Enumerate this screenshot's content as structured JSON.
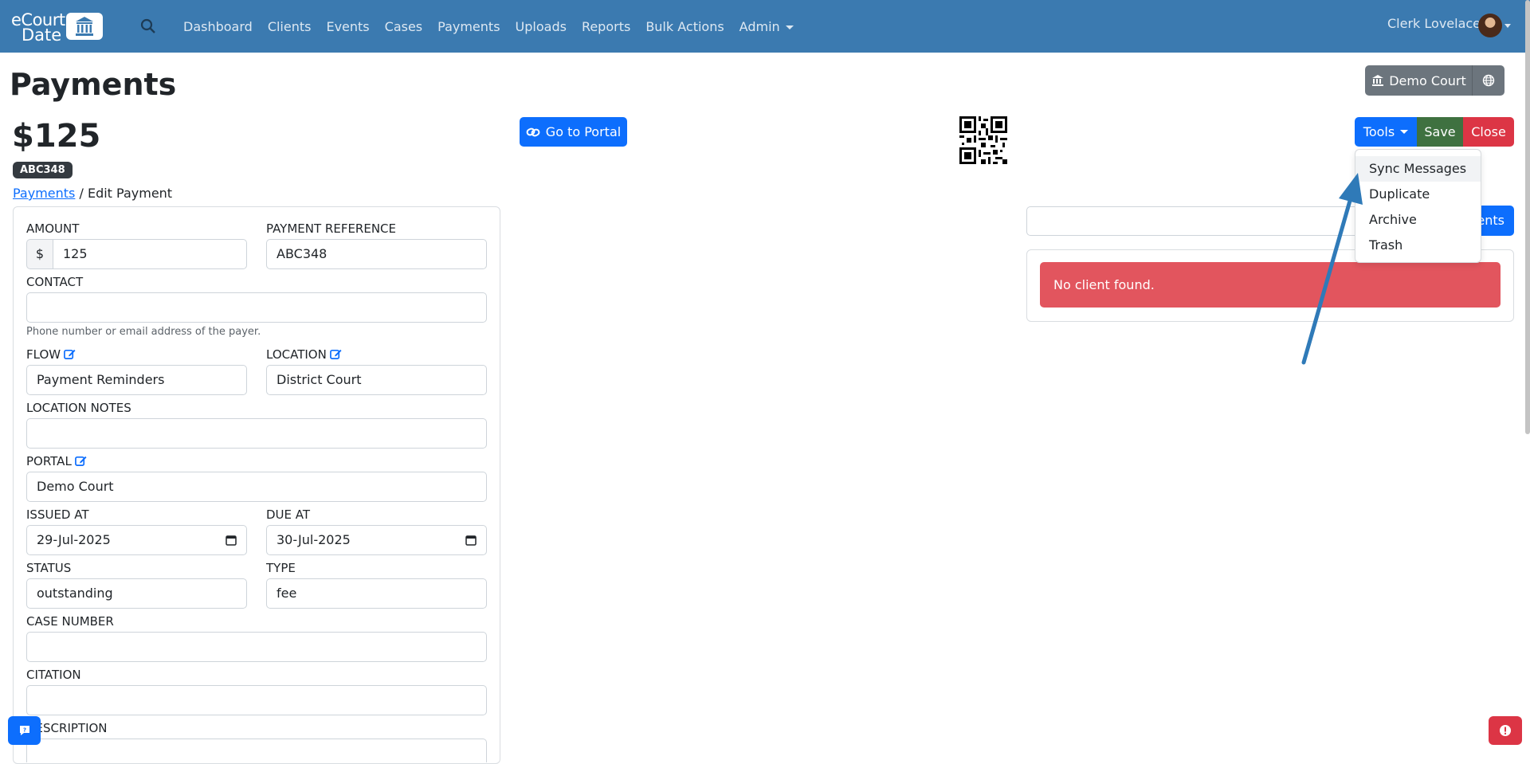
{
  "nav": {
    "brand_line1": "eCourt",
    "brand_line2": "Date",
    "links": [
      "Dashboard",
      "Clients",
      "Events",
      "Cases",
      "Payments",
      "Uploads",
      "Reports",
      "Bulk Actions"
    ],
    "admin_label": "Admin",
    "user_name": "Clerk Lovelace"
  },
  "page": {
    "title": "Payments",
    "court_button": "Demo Court",
    "amount_display": "$125",
    "reference_badge": "ABC348",
    "breadcrumb_link": "Payments",
    "breadcrumb_current": "/ Edit Payment",
    "portal_button": "Go to Portal"
  },
  "toolbar": {
    "tools_label": "Tools",
    "save_label": "Save",
    "close_label": "Close",
    "menu_items": [
      "Sync Messages",
      "Duplicate",
      "Archive",
      "Trash"
    ]
  },
  "form": {
    "amount_label": "AMOUNT",
    "amount_prefix": "$",
    "amount_value": "125",
    "reference_label": "PAYMENT REFERENCE",
    "reference_value": "ABC348",
    "contact_label": "CONTACT",
    "contact_value": "",
    "contact_help": "Phone number or email address of the payer.",
    "flow_label": "FLOW",
    "flow_value": "Payment Reminders",
    "location_label": "LOCATION",
    "location_value": "District Court",
    "location_notes_label": "LOCATION NOTES",
    "location_notes_value": "",
    "portal_label": "PORTAL",
    "portal_value": "Demo Court",
    "issued_label": "ISSUED AT",
    "issued_value": "29-Jul-2025",
    "due_label": "DUE AT",
    "due_value": "30-Jul-2025",
    "status_label": "STATUS",
    "status_value": "outstanding",
    "type_label": "TYPE",
    "type_value": "fee",
    "case_number_label": "CASE NUMBER",
    "case_number_value": "",
    "citation_label": "CITATION",
    "citation_value": "",
    "description_label": "DESCRIPTION"
  },
  "client_panel": {
    "search_button": "Clients",
    "visible_button_text": "ents",
    "alert": "No client found."
  },
  "colors": {
    "navbar": "#3b7ab0",
    "primary": "#0d6efd",
    "success": "#3f7140",
    "danger": "#dc3545",
    "secondary": "#6c757d"
  }
}
